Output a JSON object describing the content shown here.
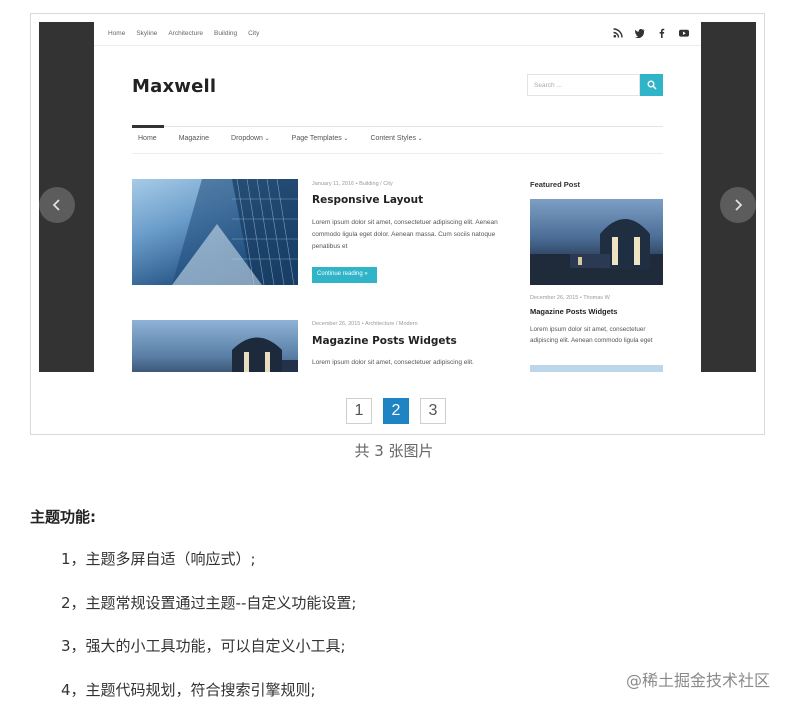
{
  "theme_site": {
    "top_links": [
      "Home",
      "Skyline",
      "Architecture",
      "Building",
      "City"
    ],
    "brand": "Maxwell",
    "search_placeholder": "Search ...",
    "nav": [
      "Home",
      "Magazine",
      "Dropdown",
      "Page Templates",
      "Content Styles"
    ],
    "posts": [
      {
        "meta": "January 11, 2016  •  Building / City",
        "title": "Responsive Layout",
        "excerpt": "Lorem ipsum dolor sit amet, consectetuer adipiscing elit. Aenean commodo ligula eget dolor. Aenean massa. Cum sociis natoque penatibus et",
        "read_more": "Continue reading »"
      },
      {
        "meta": "December 26, 2015  •  Architecture / Modern",
        "title": "Magazine Posts Widgets",
        "excerpt": "Lorem ipsum dolor sit amet, consectetuer adipiscing elit."
      }
    ],
    "sidebar": {
      "title": "Featured Post",
      "meta": "December 26, 2015  •  Thomas W",
      "post_title": "Magazine Posts Widgets",
      "excerpt": "Lorem ipsum dolor sit amet, consectetuer adipiscing elit. Aenean commodo ligula eget"
    }
  },
  "pagination": {
    "pages": [
      "1",
      "2",
      "3"
    ],
    "current": 2
  },
  "caption": "共 3 张图片",
  "section_title": "主题功能:",
  "features": [
    "1，主题多屏自适（响应式）;",
    "2，主题常规设置通过主题--自定义功能设置;",
    "3，强大的小工具功能，可以自定义小工具;",
    "4，主题代码规划，符合搜索引擎规则;"
  ],
  "watermark": "@稀土掘金技术社区",
  "colors": {
    "accent": "#2fb4c8",
    "pager_active": "#1f84c3",
    "slide_bg": "#333333"
  }
}
